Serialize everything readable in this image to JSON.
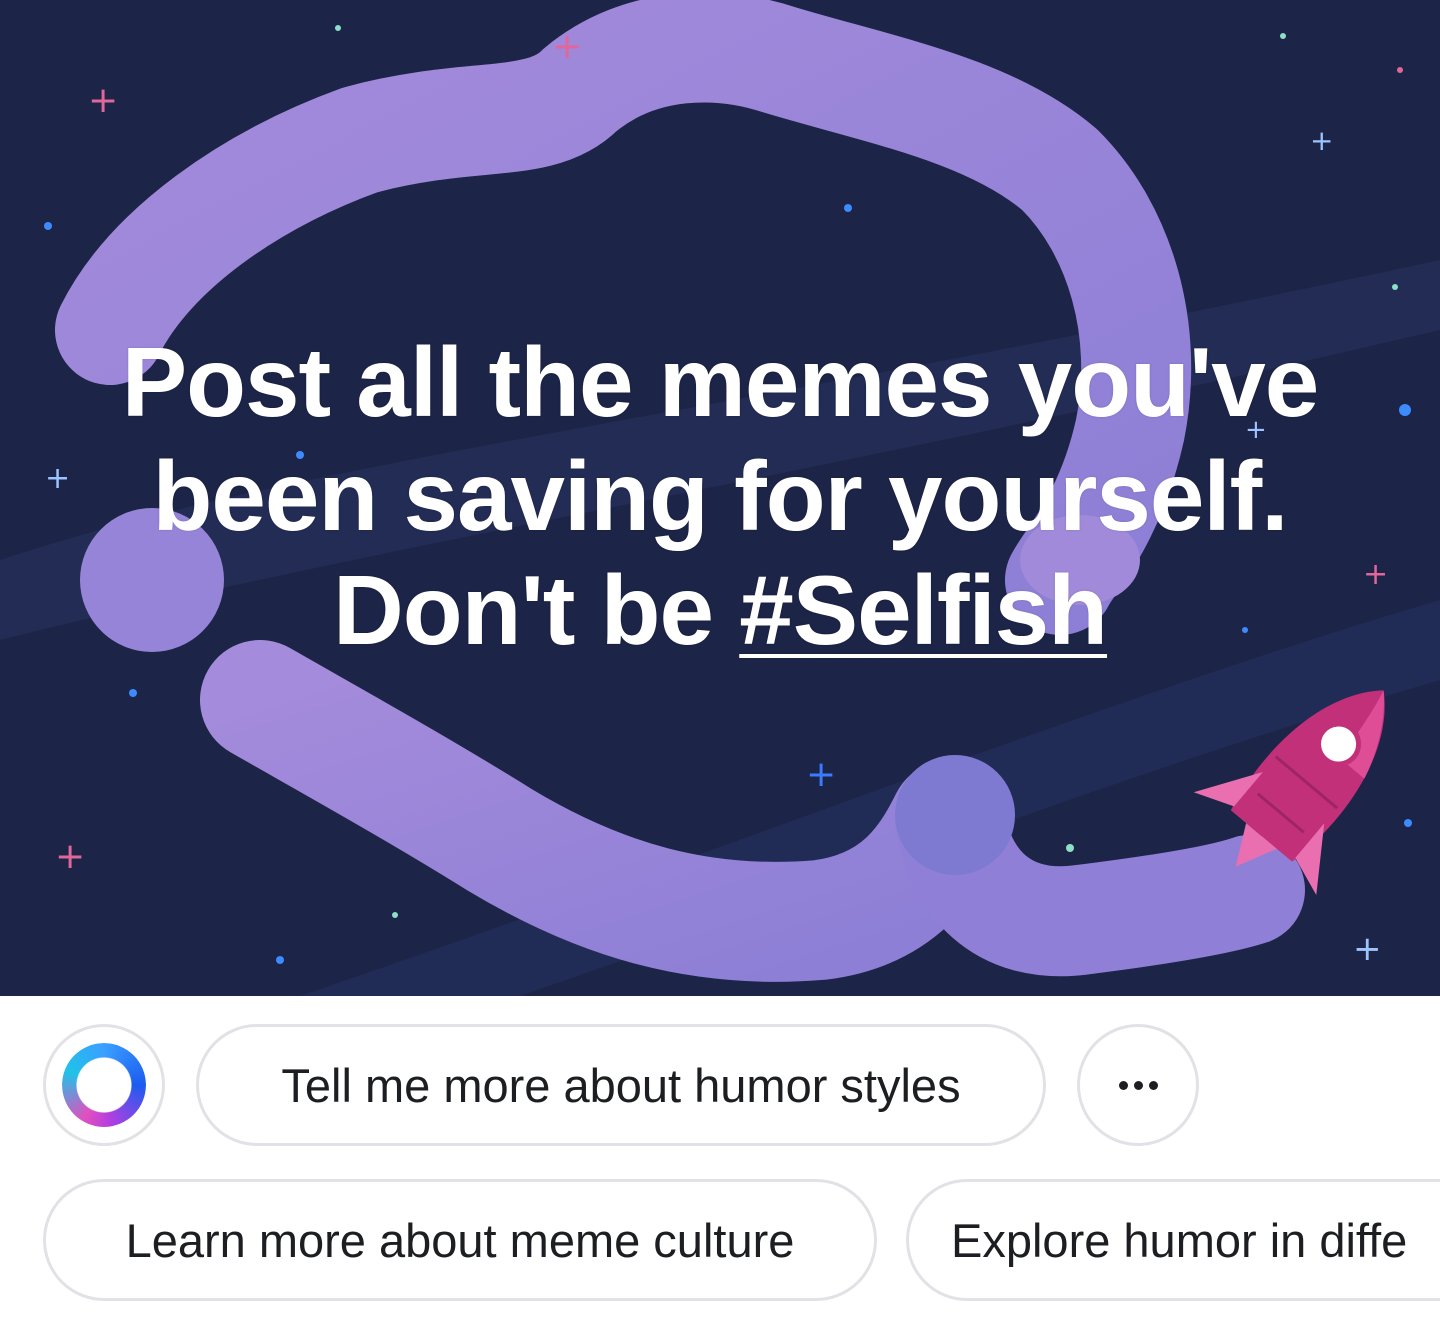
{
  "post": {
    "line1": "Post all the memes you've",
    "line2": "been saving for yourself.",
    "line3_prefix": "Don't be ",
    "hashtag": "#Selfish",
    "background_color": "#1c2447",
    "blob_color": "#9b87d8",
    "rocket_color": "#c8337a"
  },
  "suggestions": {
    "ai_icon": "meta-ai-ring-icon",
    "chips": [
      "Tell me more about humor styles",
      "Learn more about meme culture",
      "Explore humor in diffe"
    ],
    "more_icon": "more-dots-icon"
  }
}
